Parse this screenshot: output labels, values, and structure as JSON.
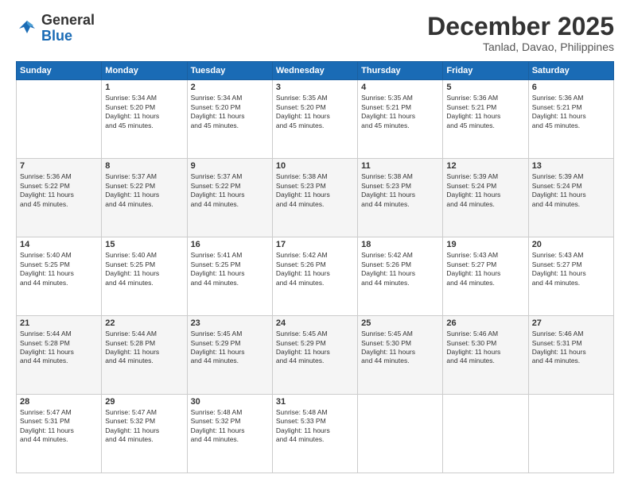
{
  "header": {
    "logo_general": "General",
    "logo_blue": "Blue",
    "month_title": "December 2025",
    "subtitle": "Tanlad, Davao, Philippines"
  },
  "days_of_week": [
    "Sunday",
    "Monday",
    "Tuesday",
    "Wednesday",
    "Thursday",
    "Friday",
    "Saturday"
  ],
  "weeks": [
    [
      {
        "day": "",
        "info": ""
      },
      {
        "day": "1",
        "info": "Sunrise: 5:34 AM\nSunset: 5:20 PM\nDaylight: 11 hours\nand 45 minutes."
      },
      {
        "day": "2",
        "info": "Sunrise: 5:34 AM\nSunset: 5:20 PM\nDaylight: 11 hours\nand 45 minutes."
      },
      {
        "day": "3",
        "info": "Sunrise: 5:35 AM\nSunset: 5:20 PM\nDaylight: 11 hours\nand 45 minutes."
      },
      {
        "day": "4",
        "info": "Sunrise: 5:35 AM\nSunset: 5:21 PM\nDaylight: 11 hours\nand 45 minutes."
      },
      {
        "day": "5",
        "info": "Sunrise: 5:36 AM\nSunset: 5:21 PM\nDaylight: 11 hours\nand 45 minutes."
      },
      {
        "day": "6",
        "info": "Sunrise: 5:36 AM\nSunset: 5:21 PM\nDaylight: 11 hours\nand 45 minutes."
      }
    ],
    [
      {
        "day": "7",
        "info": "Sunrise: 5:36 AM\nSunset: 5:22 PM\nDaylight: 11 hours\nand 45 minutes."
      },
      {
        "day": "8",
        "info": "Sunrise: 5:37 AM\nSunset: 5:22 PM\nDaylight: 11 hours\nand 44 minutes."
      },
      {
        "day": "9",
        "info": "Sunrise: 5:37 AM\nSunset: 5:22 PM\nDaylight: 11 hours\nand 44 minutes."
      },
      {
        "day": "10",
        "info": "Sunrise: 5:38 AM\nSunset: 5:23 PM\nDaylight: 11 hours\nand 44 minutes."
      },
      {
        "day": "11",
        "info": "Sunrise: 5:38 AM\nSunset: 5:23 PM\nDaylight: 11 hours\nand 44 minutes."
      },
      {
        "day": "12",
        "info": "Sunrise: 5:39 AM\nSunset: 5:24 PM\nDaylight: 11 hours\nand 44 minutes."
      },
      {
        "day": "13",
        "info": "Sunrise: 5:39 AM\nSunset: 5:24 PM\nDaylight: 11 hours\nand 44 minutes."
      }
    ],
    [
      {
        "day": "14",
        "info": "Sunrise: 5:40 AM\nSunset: 5:25 PM\nDaylight: 11 hours\nand 44 minutes."
      },
      {
        "day": "15",
        "info": "Sunrise: 5:40 AM\nSunset: 5:25 PM\nDaylight: 11 hours\nand 44 minutes."
      },
      {
        "day": "16",
        "info": "Sunrise: 5:41 AM\nSunset: 5:25 PM\nDaylight: 11 hours\nand 44 minutes."
      },
      {
        "day": "17",
        "info": "Sunrise: 5:42 AM\nSunset: 5:26 PM\nDaylight: 11 hours\nand 44 minutes."
      },
      {
        "day": "18",
        "info": "Sunrise: 5:42 AM\nSunset: 5:26 PM\nDaylight: 11 hours\nand 44 minutes."
      },
      {
        "day": "19",
        "info": "Sunrise: 5:43 AM\nSunset: 5:27 PM\nDaylight: 11 hours\nand 44 minutes."
      },
      {
        "day": "20",
        "info": "Sunrise: 5:43 AM\nSunset: 5:27 PM\nDaylight: 11 hours\nand 44 minutes."
      }
    ],
    [
      {
        "day": "21",
        "info": "Sunrise: 5:44 AM\nSunset: 5:28 PM\nDaylight: 11 hours\nand 44 minutes."
      },
      {
        "day": "22",
        "info": "Sunrise: 5:44 AM\nSunset: 5:28 PM\nDaylight: 11 hours\nand 44 minutes."
      },
      {
        "day": "23",
        "info": "Sunrise: 5:45 AM\nSunset: 5:29 PM\nDaylight: 11 hours\nand 44 minutes."
      },
      {
        "day": "24",
        "info": "Sunrise: 5:45 AM\nSunset: 5:29 PM\nDaylight: 11 hours\nand 44 minutes."
      },
      {
        "day": "25",
        "info": "Sunrise: 5:45 AM\nSunset: 5:30 PM\nDaylight: 11 hours\nand 44 minutes."
      },
      {
        "day": "26",
        "info": "Sunrise: 5:46 AM\nSunset: 5:30 PM\nDaylight: 11 hours\nand 44 minutes."
      },
      {
        "day": "27",
        "info": "Sunrise: 5:46 AM\nSunset: 5:31 PM\nDaylight: 11 hours\nand 44 minutes."
      }
    ],
    [
      {
        "day": "28",
        "info": "Sunrise: 5:47 AM\nSunset: 5:31 PM\nDaylight: 11 hours\nand 44 minutes."
      },
      {
        "day": "29",
        "info": "Sunrise: 5:47 AM\nSunset: 5:32 PM\nDaylight: 11 hours\nand 44 minutes."
      },
      {
        "day": "30",
        "info": "Sunrise: 5:48 AM\nSunset: 5:32 PM\nDaylight: 11 hours\nand 44 minutes."
      },
      {
        "day": "31",
        "info": "Sunrise: 5:48 AM\nSunset: 5:33 PM\nDaylight: 11 hours\nand 44 minutes."
      },
      {
        "day": "",
        "info": ""
      },
      {
        "day": "",
        "info": ""
      },
      {
        "day": "",
        "info": ""
      }
    ]
  ]
}
